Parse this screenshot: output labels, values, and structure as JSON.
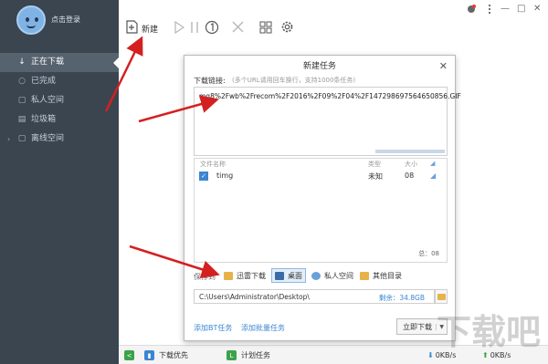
{
  "window": {
    "minimize": "—",
    "maximize": "□",
    "close": "✕"
  },
  "sidebar": {
    "login_label": "点击登录",
    "items": [
      {
        "icon": "↓",
        "label": "正在下载",
        "active": true
      },
      {
        "icon": "○",
        "label": "已完成",
        "active": false
      },
      {
        "icon": "▢",
        "label": "私人空间",
        "active": false
      },
      {
        "icon": "▤",
        "label": "垃圾箱",
        "active": false
      },
      {
        "icon": "▢",
        "label": "离线空间",
        "active": false,
        "expand": "›"
      }
    ]
  },
  "toolbar": {
    "new_label": "新建",
    "icons": [
      "new-icon",
      "play-icon",
      "pause-icon",
      "one-icon",
      "delete-icon",
      "grid-icon",
      "settings-icon"
    ]
  },
  "dialog": {
    "title": "新建任务",
    "close": "✕",
    "link_label": "下载链接:",
    "link_hint": "(多个URL请用回车换行，支持1000条任务)",
    "url": "mg8%2Fwb%2Frecom%2F2016%2F09%2F04%2F147298697564650856.GIF",
    "list": {
      "headers": {
        "name": "文件名称",
        "type": "类型",
        "size": "大小"
      },
      "rows": [
        {
          "checked": true,
          "name": "timg",
          "type": "未知",
          "size": "08"
        }
      ],
      "count": "总：08"
    },
    "save_label": "保存到",
    "locations": [
      {
        "label": "迅雷下载",
        "selected": false,
        "color": "#e8b24a"
      },
      {
        "label": "桌面",
        "selected": true,
        "color": "#3b6aa8"
      },
      {
        "label": "私人空间",
        "selected": false,
        "color": "#6aa0d8"
      },
      {
        "label": "其他目录",
        "selected": false,
        "color": "#e8b24a"
      }
    ],
    "path": "C:\\Users\\Administrator\\Desktop\\",
    "free_space": "剩余：34.8GB",
    "link_bt": "添加BT任务",
    "link_batch": "添加批量任务",
    "start_button": "立即下载",
    "start_arrow": "▼"
  },
  "bottombar": {
    "priority_label": "下载优先",
    "schedule_label": "计划任务",
    "down_speed": "0KB/s",
    "up_speed": "0KB/s",
    "left_btn": "<"
  },
  "watermark": "下载吧",
  "colors": {
    "sidebar": "#3a4550",
    "accent": "#3b86d2",
    "arrow": "#d42020"
  }
}
